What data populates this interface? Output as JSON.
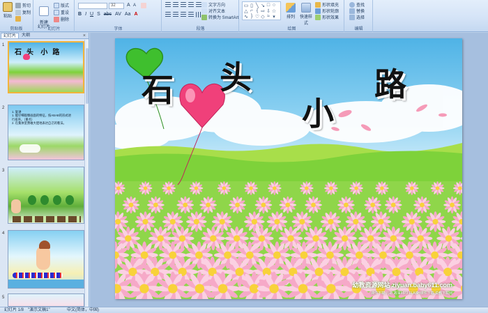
{
  "ribbon": {
    "clipboard": {
      "label": "剪贴板",
      "paste": "粘贴",
      "cut": "剪切",
      "copy": "复制",
      "format": "格式刷"
    },
    "slides": {
      "label": "幻灯片",
      "new_slide": "新建\n幻灯片",
      "layout": "版式",
      "reset": "重设",
      "delete": "删除"
    },
    "font": {
      "label": "字体",
      "font_name": "",
      "font_size": "32"
    },
    "paragraph": {
      "label": "段落",
      "text_direction": "文字方向",
      "align_text": "对齐文本",
      "smartart": "转换为 SmartArt"
    },
    "drawing": {
      "label": "绘图",
      "arrange": "排列",
      "quick_styles": "快速样式",
      "fill": "形状填充",
      "outline": "形状轮廓",
      "effects": "形状效果"
    },
    "editing": {
      "label": "编辑",
      "find": "查找",
      "replace": "替换",
      "select": "选择"
    }
  },
  "panel": {
    "tabs": [
      "幻灯片",
      "大纲"
    ],
    "close": "×",
    "thumbnails": [
      {
        "num": "1",
        "title": "石  头   小  路"
      },
      {
        "num": "2",
        "lines": [
          "1. 复讲",
          "1. 能仔细观察画面的特征，按ABAB的形式进",
          "   行排序。（重点）",
          "2. 在集体里勇敢大胆地表达自己的看法。"
        ]
      },
      {
        "num": "3"
      },
      {
        "num": "4",
        "caption": ""
      },
      {
        "num": "5"
      }
    ]
  },
  "slide": {
    "title_chars": [
      "石",
      "头",
      "小",
      "路"
    ],
    "watermark": "幼教资源网站  ziyuan.baby611.com",
    "watermark_sub": "课件下载    儿歌    故事MP3    FLASH课件下载    说教下载网"
  },
  "colors": {
    "accent": "#f3b43a",
    "ribbon_bg": "#d5e4f7",
    "sky": "#4fb3e6",
    "grass": "#7ed23a",
    "balloon_pink": "#f0407a",
    "balloon_green": "#3fbf2e"
  },
  "status": {
    "slide_info": "幻灯片 1/8",
    "theme": "\"演示文稿1\"",
    "language": "中文(简体，中国)"
  }
}
